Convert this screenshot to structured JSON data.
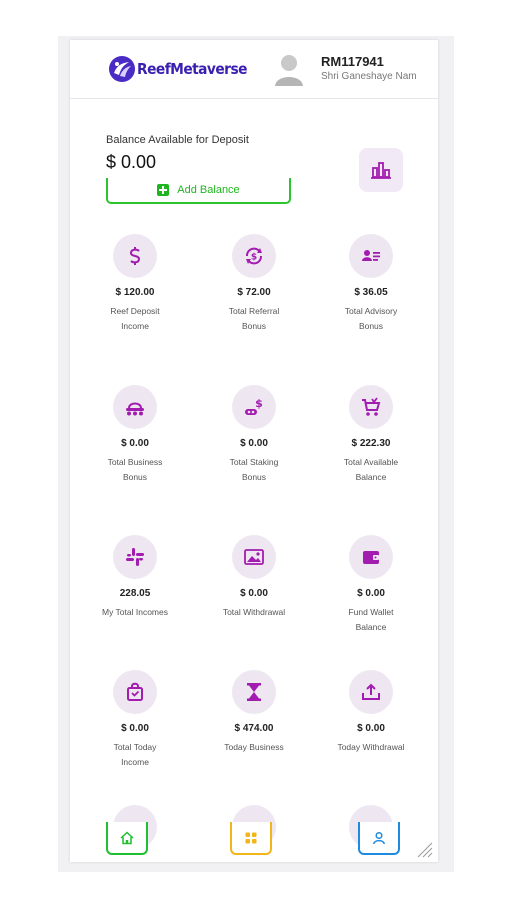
{
  "brand": {
    "name": "ReefMetaverse",
    "primary_color": "#3a1fb0",
    "accent_color": "#a21caf"
  },
  "user": {
    "id": "RM117941",
    "name": "Shri Ganeshaye Nam"
  },
  "balance": {
    "label": "Balance Available for Deposit",
    "amount": "$ 0.00",
    "add_button_label": "Add Balance"
  },
  "stats": [
    {
      "icon": "dollar-icon",
      "amount": "$ 120.00",
      "label": "Reef Deposit Income"
    },
    {
      "icon": "dollar-exchange-icon",
      "amount": "$ 72.00",
      "label": "Total Referral Bonus"
    },
    {
      "icon": "id-card-icon",
      "amount": "$ 36.05",
      "label": "Total Advisory Bonus"
    },
    {
      "icon": "business-icon",
      "amount": "$ 0.00",
      "label": "Total Business Bonus"
    },
    {
      "icon": "staking-icon",
      "amount": "$ 0.00",
      "label": "Total Staking Bonus"
    },
    {
      "icon": "cart-icon",
      "amount": "$ 222.30",
      "label": "Total Available Balance"
    },
    {
      "icon": "slack-icon",
      "amount": "228.05",
      "label": "My Total Incomes"
    },
    {
      "icon": "image-dollar-icon",
      "amount": "$ 0.00",
      "label": "Total Withdrawal"
    },
    {
      "icon": "wallet-icon",
      "amount": "$ 0.00",
      "label": "Fund Wallet Balance"
    },
    {
      "icon": "shopping-bag-icon",
      "amount": "$ 0.00",
      "label": "Total Today Income"
    },
    {
      "icon": "hourglass-icon",
      "amount": "$ 474.00",
      "label": "Today Business"
    },
    {
      "icon": "upload-icon",
      "amount": "$ 0.00",
      "label": "Today Withdrawal"
    }
  ],
  "bottom_nav": [
    {
      "icon": "home-icon",
      "color": "#1fbf2f"
    },
    {
      "icon": "grid-icon",
      "color": "#f2b51a"
    },
    {
      "icon": "user-icon",
      "color": "#1f8be0"
    }
  ]
}
